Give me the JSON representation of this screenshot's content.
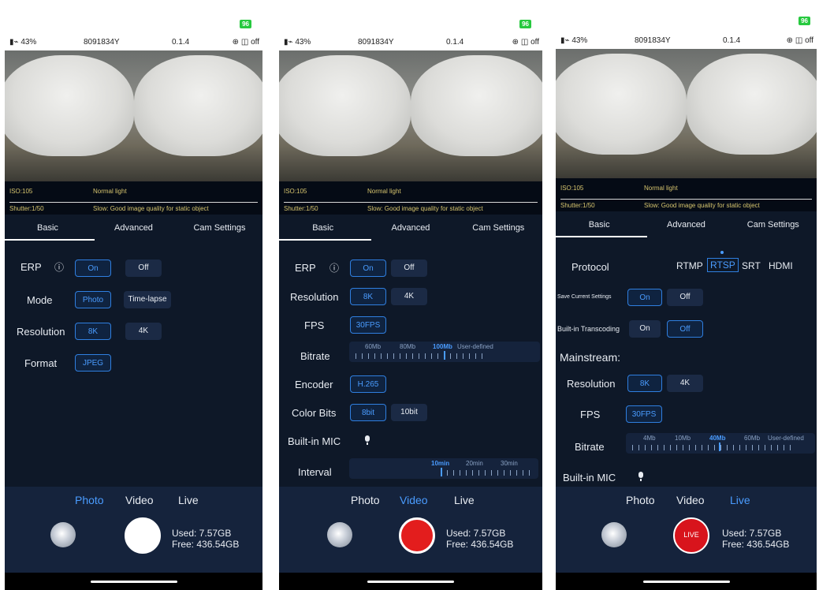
{
  "common": {
    "battery_level": "96",
    "status_battery": "43%",
    "device_id": "8091834Y",
    "version": "0.1.4",
    "wifi_status": "off",
    "iso": "ISO:105",
    "light": "Normal light",
    "shutter": "Shutter:1/50",
    "shutter_hint": "Slow: Good image quality for static object",
    "tabs": [
      "Basic",
      "Advanced",
      "Cam Settings"
    ],
    "modes": [
      "Photo",
      "Video",
      "Live"
    ],
    "storage_used": "Used: 7.57GB",
    "storage_free": "Free: 436.54GB"
  },
  "screen1": {
    "active_mode": "Photo",
    "erp_label": "ERP",
    "erp_on": "On",
    "erp_off": "Off",
    "mode_label": "Mode",
    "mode_photo": "Photo",
    "mode_timelapse": "Time-lapse",
    "resolution_label": "Resolution",
    "res_8k": "8K",
    "res_4k": "4K",
    "format_label": "Format",
    "format_jpeg": "JPEG"
  },
  "screen2": {
    "active_mode": "Video",
    "erp_label": "ERP",
    "erp_on": "On",
    "erp_off": "Off",
    "resolution_label": "Resolution",
    "res_8k": "8K",
    "res_4k": "4K",
    "fps_label": "FPS",
    "fps_value": "30FPS",
    "bitrate_label": "Bitrate",
    "bitrate_options": [
      "60Mb",
      "80Mb",
      "100Mb",
      "User-defined"
    ],
    "bitrate_selected": "100Mb",
    "encoder_label": "Encoder",
    "encoder_value": "H.265",
    "colorbits_label": "Color Bits",
    "bits_8": "8bit",
    "bits_10": "10bit",
    "mic_label": "Built-in MIC",
    "interval_label": "Interval",
    "interval_options": [
      "10min",
      "20min",
      "30min"
    ],
    "interval_selected": "10min"
  },
  "screen3": {
    "active_mode": "Live",
    "protocol_label": "Protocol",
    "protocols": [
      "RTMP",
      "RTSP",
      "SRT",
      "HDMI"
    ],
    "protocol_selected": "RTSP",
    "save_label": "Save Current Settings",
    "save_on": "On",
    "save_off": "Off",
    "transcode_label": "Built-in Transcoding",
    "transcode_on": "On",
    "transcode_off": "Off",
    "mainstream_label": "Mainstream:",
    "resolution_label": "Resolution",
    "res_8k": "8K",
    "res_4k": "4K",
    "fps_label": "FPS",
    "fps_value": "30FPS",
    "bitrate_label": "Bitrate",
    "bitrate_options": [
      "4Mb",
      "10Mb",
      "40Mb",
      "60Mb",
      "User-defined"
    ],
    "bitrate_selected": "40Mb",
    "mic_label": "Built-in MIC",
    "live_button": "LIVE"
  }
}
